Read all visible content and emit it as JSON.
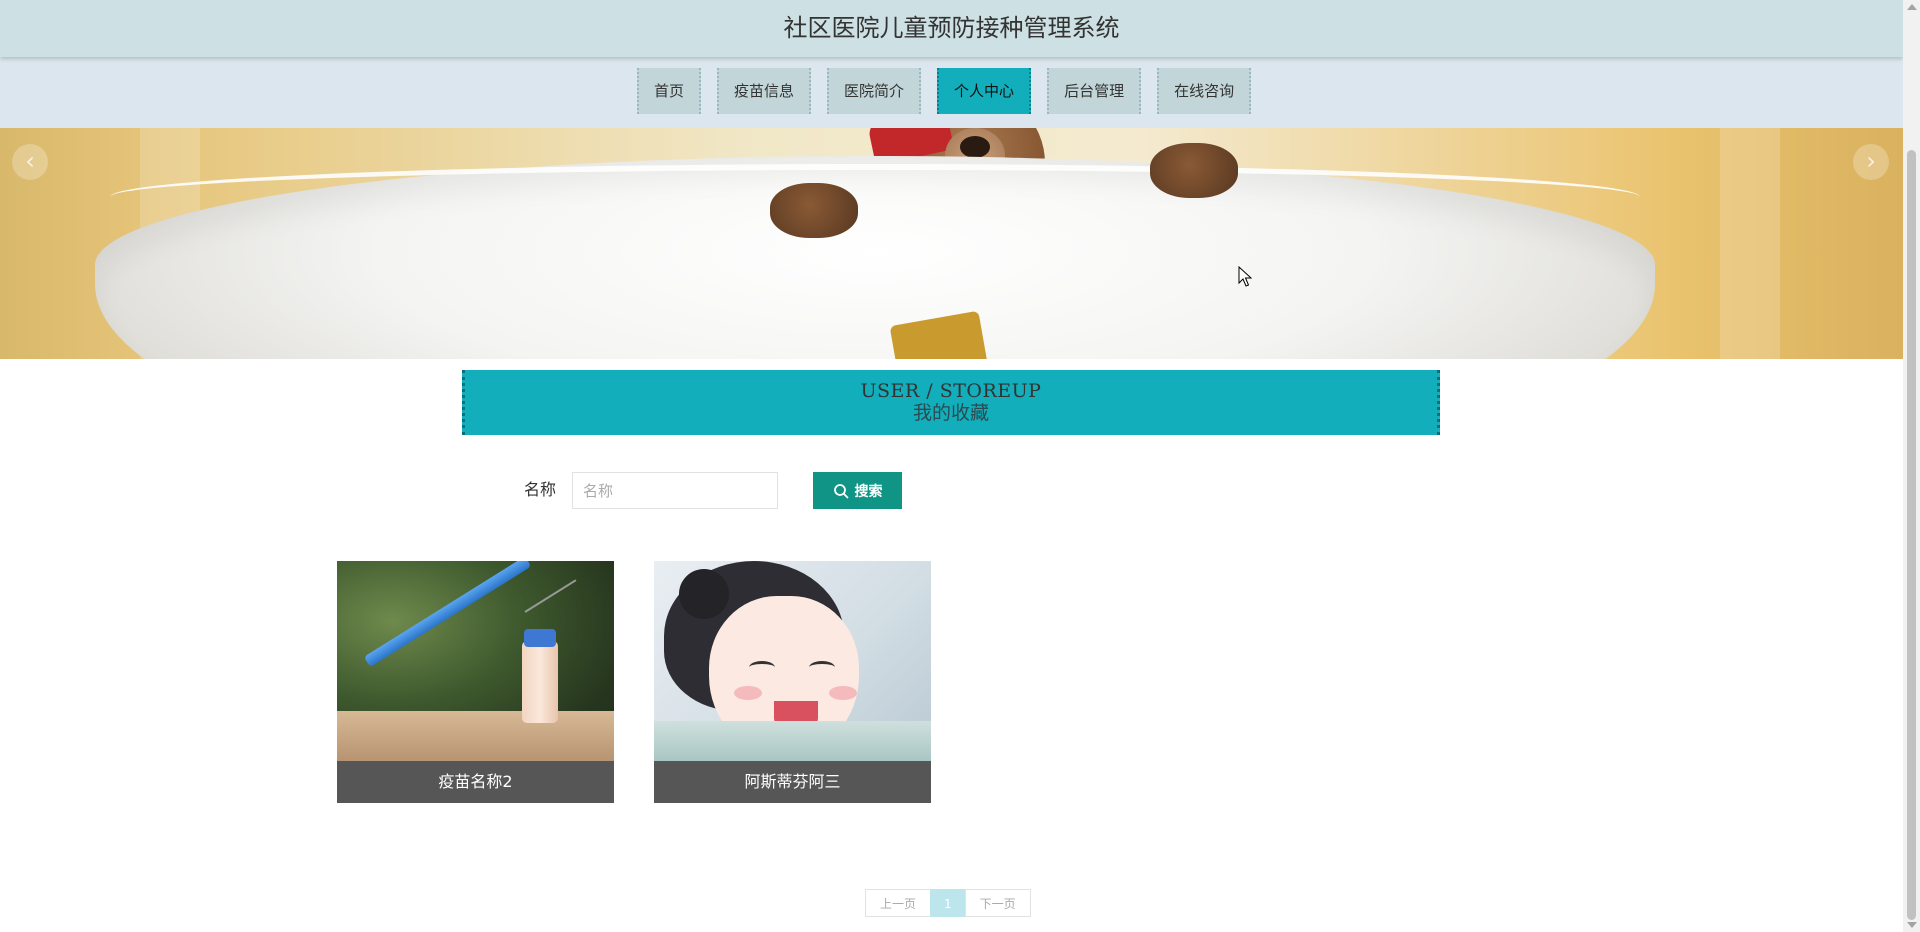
{
  "header": {
    "title": "社区医院儿童预防接种管理系统"
  },
  "nav": {
    "items": [
      {
        "label": "首页"
      },
      {
        "label": "疫苗信息"
      },
      {
        "label": "医院简介"
      },
      {
        "label": "个人中心"
      },
      {
        "label": "后台管理"
      },
      {
        "label": "在线咨询"
      }
    ],
    "active": "个人中心"
  },
  "banner": {
    "prev_icon": "chevron-left-icon",
    "next_icon": "chevron-right-icon"
  },
  "section": {
    "title_en": "USER / STOREUP",
    "title_zh": "我的收藏"
  },
  "search": {
    "label": "名称",
    "placeholder": "名称",
    "value": "",
    "button_label": "搜索",
    "button_icon": "search-icon"
  },
  "cards": [
    {
      "name": "疫苗名称2"
    },
    {
      "name": "阿斯蒂芬阿三"
    }
  ],
  "pagination": {
    "prev_label": "上一页",
    "current_page": "1",
    "next_label": "下一页"
  },
  "colors": {
    "accent": "#12aebb",
    "button": "#0f9486",
    "header_bg": "#cde0e4",
    "nav_bg": "#dbe6ee",
    "caption_bg": "#565656"
  }
}
